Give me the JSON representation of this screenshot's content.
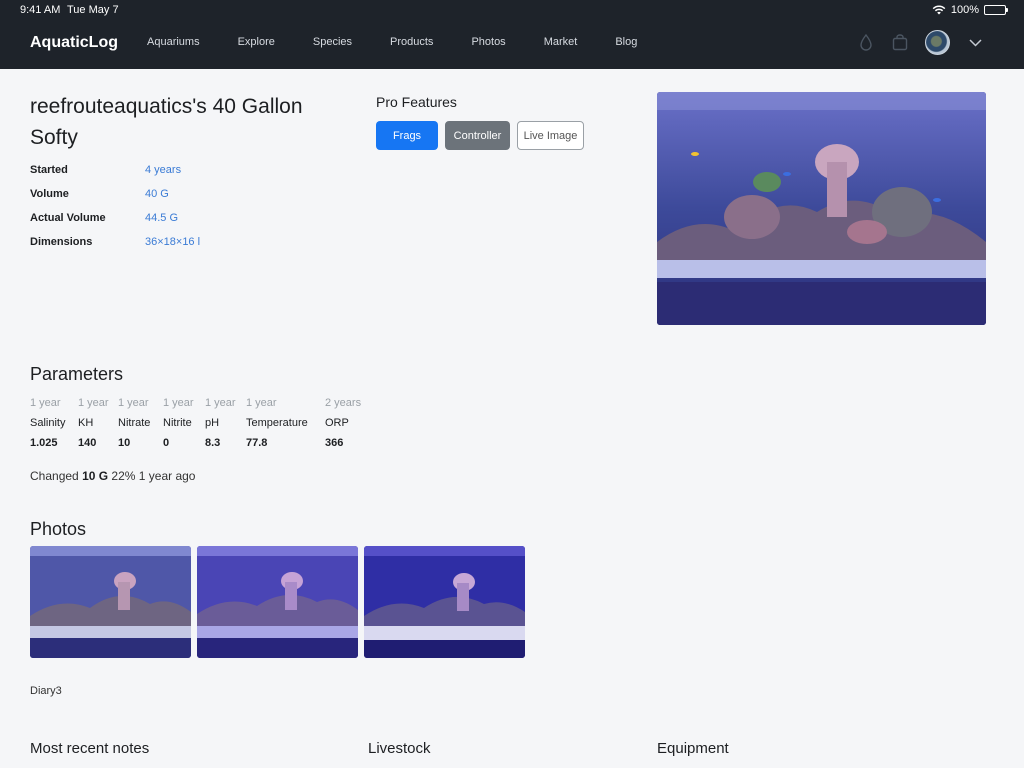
{
  "status": {
    "time": "9:41 AM",
    "date": "Tue May 7",
    "battery": "100%"
  },
  "nav": {
    "brand": "AquaticLog",
    "links": [
      "Aquariums",
      "Explore",
      "Species",
      "Products",
      "Photos",
      "Market",
      "Blog"
    ],
    "icons": [
      "water-drop-icon",
      "bag-icon",
      "avatar",
      "chevron-down-icon"
    ]
  },
  "tank": {
    "title": "reefrouteaquatics's 40 Gallon Softy",
    "info": [
      {
        "label": "Started",
        "value": "4 years"
      },
      {
        "label": "Volume",
        "value": "40 G"
      },
      {
        "label": "Actual Volume",
        "value": "44.5 G"
      },
      {
        "label": "Dimensions",
        "value": "36×18×16 l"
      }
    ]
  },
  "pro": {
    "title": "Pro Features",
    "buttons": [
      "Frags",
      "Controller",
      "Live Image"
    ]
  },
  "parameters": {
    "title": "Parameters",
    "items": [
      {
        "age": "1 year",
        "name": "Salinity",
        "value": "1.025"
      },
      {
        "age": "1 year",
        "name": "KH",
        "value": "140"
      },
      {
        "age": "1 year",
        "name": "Nitrate",
        "value": "10"
      },
      {
        "age": "1 year",
        "name": "Nitrite",
        "value": "0"
      },
      {
        "age": "1 year",
        "name": "pH",
        "value": "8.3"
      },
      {
        "age": "1 year",
        "name": "Temperature",
        "value": "77.8"
      },
      {
        "age": "2 years",
        "name": "ORP",
        "value": "366"
      }
    ],
    "changed_prefix": "Changed",
    "changed_amount": "10 G",
    "changed_suffix": "22% 1 year ago"
  },
  "photos": {
    "title": "Photos",
    "caption": "Diary3"
  },
  "sections": {
    "notes": "Most recent notes",
    "livestock": "Livestock",
    "equipment": "Equipment"
  }
}
